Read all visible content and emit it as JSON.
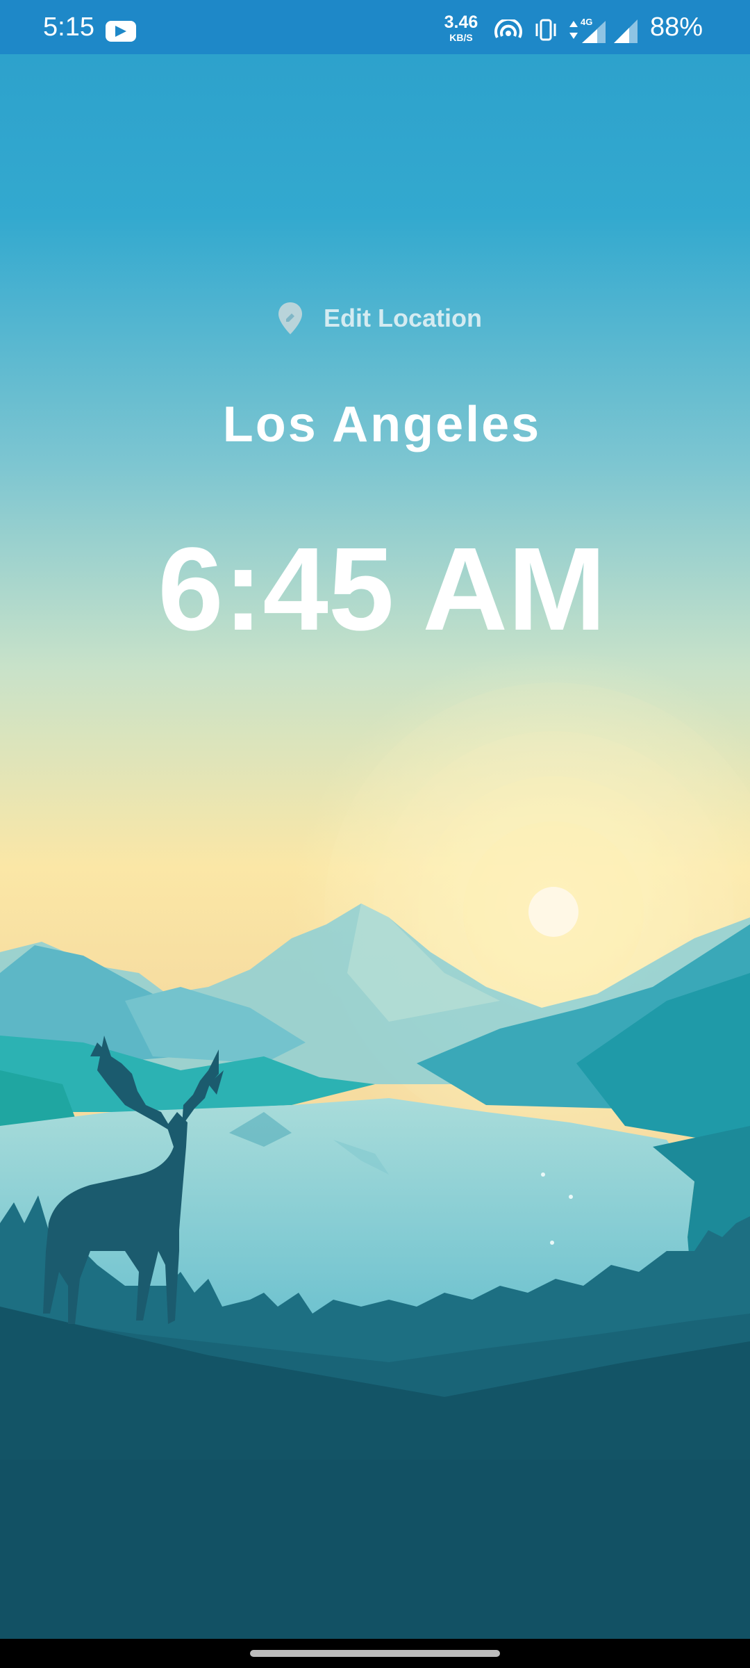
{
  "status_bar": {
    "time": "5:15",
    "app_icon": "youtube-icon",
    "net_speed_value": "3.46",
    "net_speed_unit": "KB/S",
    "icons": [
      "hotspot-icon",
      "vibrate-icon",
      "data-arrows-icon",
      "signal-4g-icon",
      "signal-icon"
    ],
    "network_type": "4G",
    "battery": "88%"
  },
  "main": {
    "edit_location_icon": "location-pin-icon",
    "edit_location_label": "Edit Location",
    "city": "Los Angeles",
    "time": "6:45 AM"
  },
  "colors": {
    "status_bar": "#1e88c8",
    "sky_top": "#2b9fcb",
    "sky_horizon": "#fbe7a6",
    "sun": "#fff8e6",
    "water": "#8fd2d8",
    "foreground": "#135466"
  }
}
